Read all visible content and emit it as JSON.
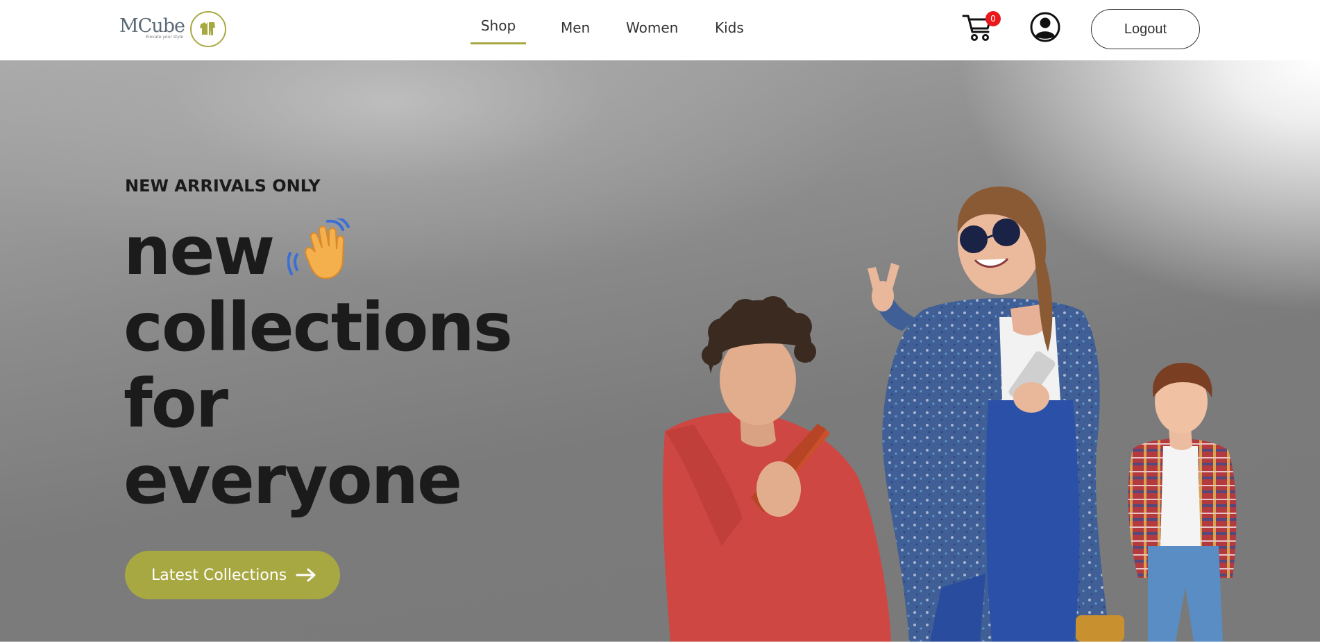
{
  "brand": {
    "name": "MCube",
    "tagline": "Elevate your style",
    "accent_color": "#a8a843"
  },
  "nav": {
    "items": [
      {
        "label": "Shop",
        "active": true
      },
      {
        "label": "Men",
        "active": false
      },
      {
        "label": "Women",
        "active": false
      },
      {
        "label": "Kids",
        "active": false
      }
    ]
  },
  "header": {
    "cart_icon": "shopping-cart-icon",
    "cart_count": "0",
    "profile_icon": "user-circle-icon",
    "logout_label": "Logout"
  },
  "hero": {
    "eyebrow": "NEW ARRIVALS ONLY",
    "title_lines": [
      "new",
      "collections",
      "for",
      "everyone"
    ],
    "title_emoji_icon": "waving-hand-icon",
    "cta_label": "Latest Collections",
    "cta_icon": "arrow-right-icon",
    "image_alt_icon": "hero-models-image"
  }
}
